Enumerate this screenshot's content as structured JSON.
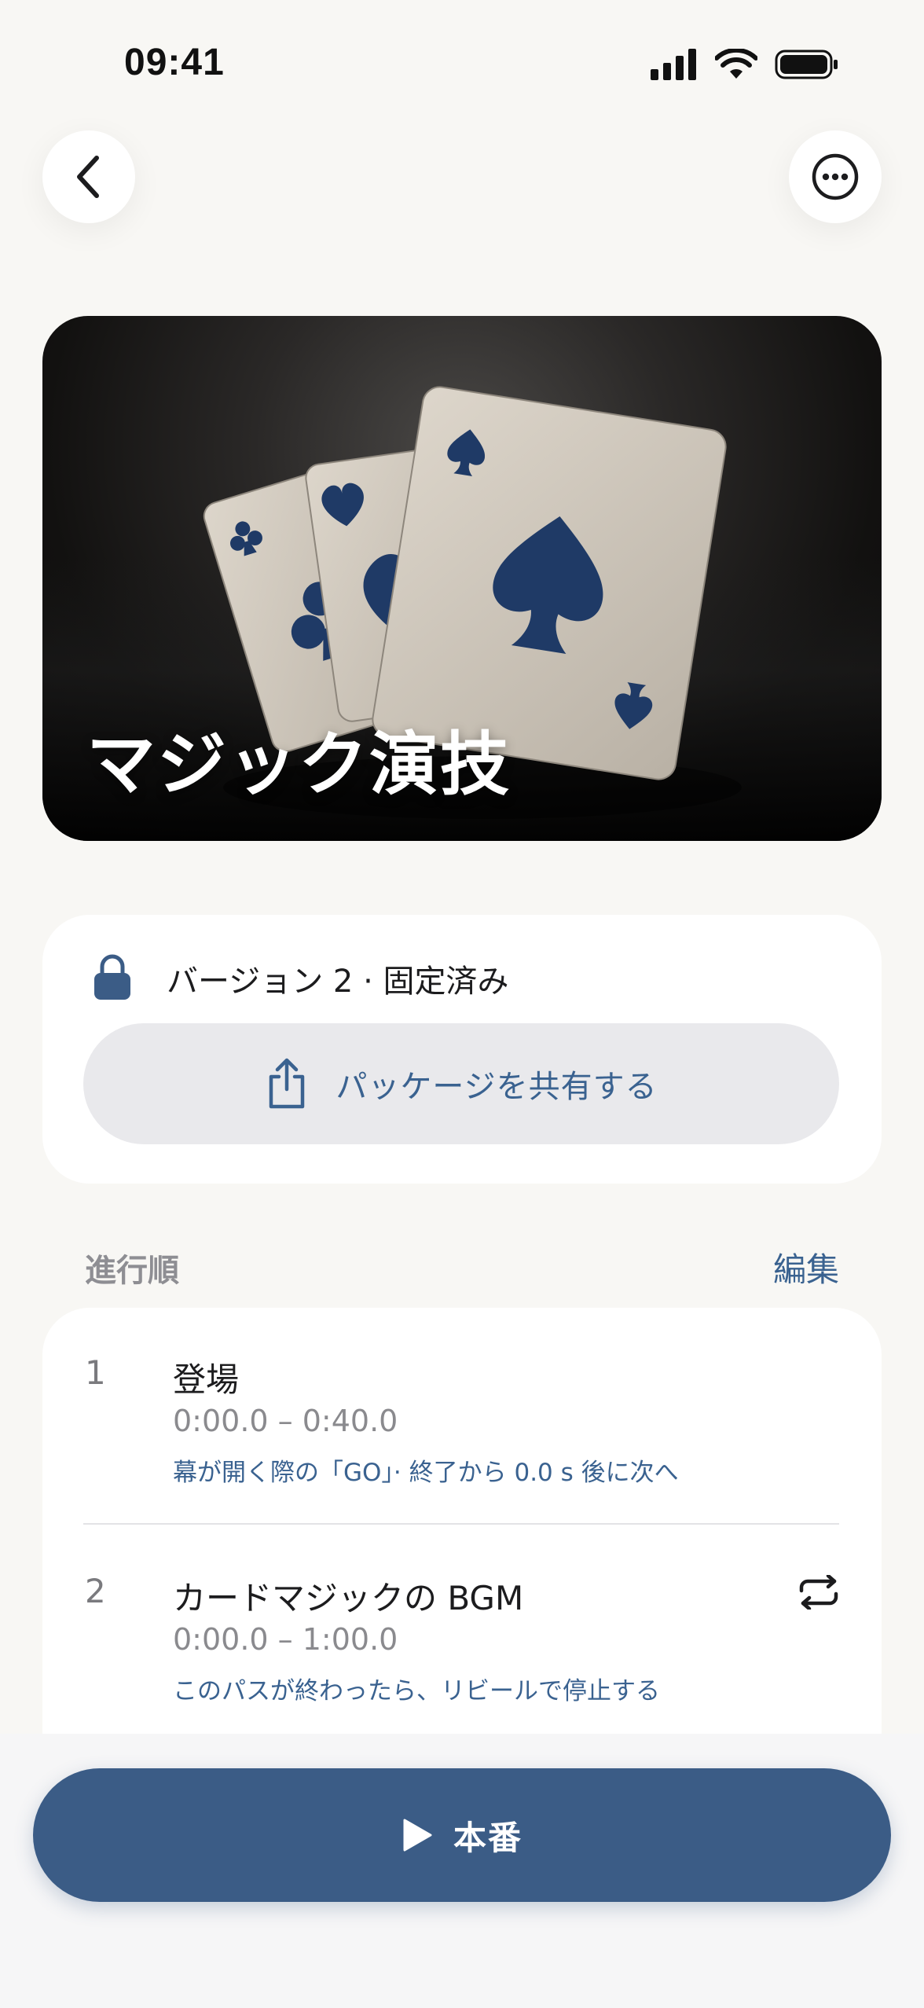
{
  "status_bar": {
    "time": "09:41"
  },
  "hero": {
    "title": "マジック演技"
  },
  "version": {
    "text": "バージョン 2 · 固定済み",
    "share_label": "パッケージを共有する"
  },
  "run_order": {
    "section_label": "進行順",
    "edit_label": "編集",
    "items": [
      {
        "index": "1",
        "title": "登場",
        "time": "0:00.0 – 0:40.0",
        "note": "幕が開く際の「GO」· 終了から 0.0 s 後に次へ",
        "repeat": false
      },
      {
        "index": "2",
        "title": "カードマジックの BGM",
        "time": "0:00.0 – 1:00.0",
        "note": "このパスが終わったら、リビールで停止する",
        "repeat": true
      }
    ]
  },
  "play_button": {
    "label": "本番"
  },
  "colors": {
    "accent": "#3b5c86",
    "link": "#3a6290",
    "background": "#f8f7f4"
  }
}
